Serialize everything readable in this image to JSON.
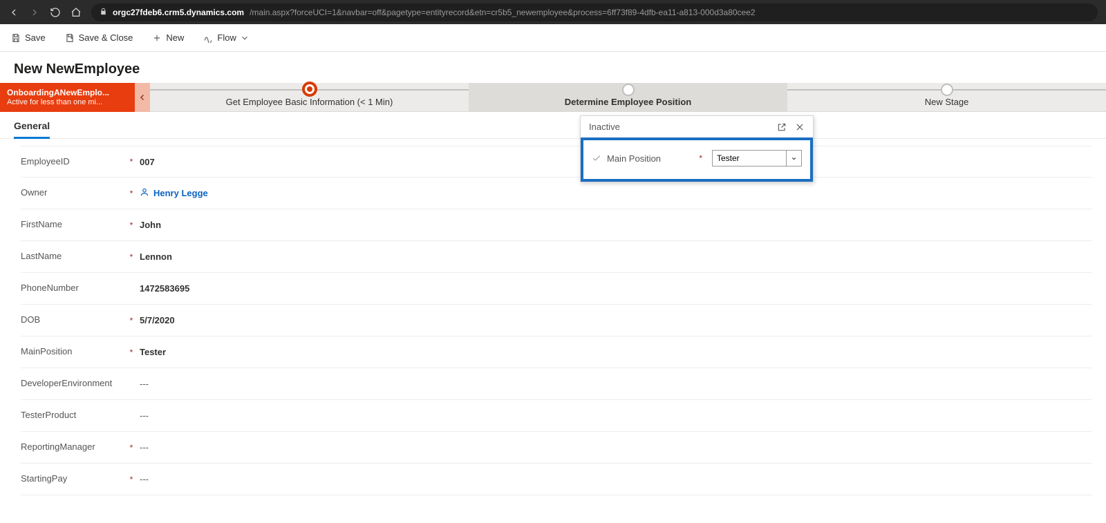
{
  "browser": {
    "url_host": "orgc27fdeb6.crm5.dynamics.com",
    "url_path": "/main.aspx?forceUCI=1&navbar=off&pagetype=entityrecord&etn=cr5b5_newemployee&process=6ff73f89-4dfb-ea11-a813-000d3a80cee2"
  },
  "commands": {
    "save": "Save",
    "save_close": "Save & Close",
    "new": "New",
    "flow": "Flow"
  },
  "page": {
    "title": "New NewEmployee"
  },
  "process": {
    "name": "OnboardingANewEmplo...",
    "status_line": "Active for less than one mi...",
    "stages": [
      {
        "label": "Get Employee Basic Information  (< 1 Min)",
        "current": true
      },
      {
        "label": "Determine Employee Position",
        "active_label": true
      },
      {
        "label": "New Stage"
      }
    ]
  },
  "tabs": [
    {
      "label": "General",
      "active": true
    }
  ],
  "form_rows": [
    {
      "label": "EmployeeID",
      "required": true,
      "value": "007"
    },
    {
      "label": "Owner",
      "required": true,
      "value": "Henry Legge",
      "is_link": true
    },
    {
      "label": "FirstName",
      "required": true,
      "value": "John"
    },
    {
      "label": "LastName",
      "required": true,
      "value": "Lennon"
    },
    {
      "label": "PhoneNumber",
      "required": false,
      "value": "1472583695"
    },
    {
      "label": "DOB",
      "required": true,
      "value": "5/7/2020"
    },
    {
      "label": "MainPosition",
      "required": true,
      "value": "Tester"
    },
    {
      "label": "DeveloperEnvironment",
      "required": false,
      "value": "---",
      "placeholder": true
    },
    {
      "label": "TesterProduct",
      "required": false,
      "value": "---",
      "placeholder": true
    },
    {
      "label": "ReportingManager",
      "required": true,
      "value": "---",
      "placeholder": true
    },
    {
      "label": "StartingPay",
      "required": true,
      "value": "---",
      "placeholder": true
    }
  ],
  "flyout": {
    "status": "Inactive",
    "field_label": "Main Position",
    "field_required": true,
    "field_value": "Tester"
  }
}
